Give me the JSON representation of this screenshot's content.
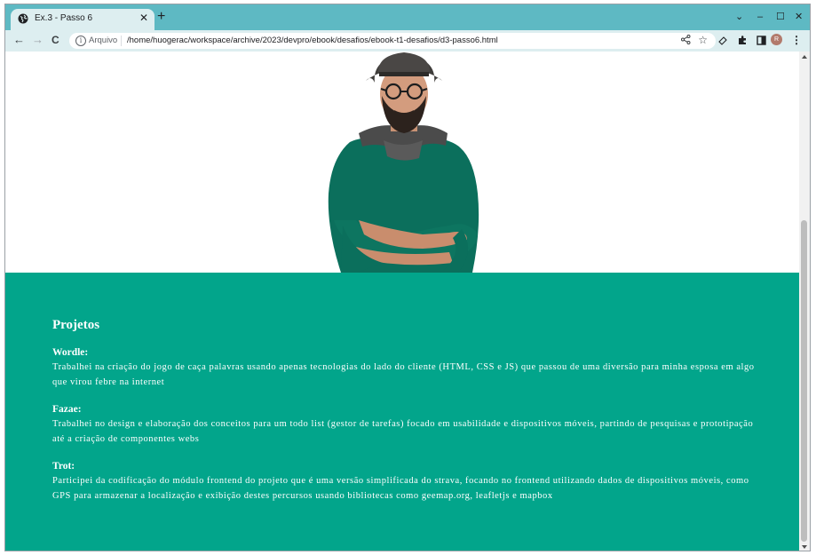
{
  "browser": {
    "tab_title": "Ex.3 - Passo 6",
    "tab_close": "✕",
    "new_tab": "+",
    "window_controls": {
      "dropdown": "⌄",
      "minimize": "–",
      "maximize": "☐",
      "close": "✕"
    },
    "nav": {
      "back": "←",
      "forward": "→",
      "reload": "C"
    },
    "address": {
      "scheme_label": "Arquivo",
      "url": "/home/huogerac/workspace/archive/2023/devpro/ebook/desafios/ebook-t1-desafios/d3-passo6.html"
    },
    "avatar_initial": "R",
    "colors": {
      "tabbar": "#5eb9c3",
      "toolbar": "#ddeef0"
    }
  },
  "page": {
    "hero_image": "man-with-hat-glasses-green-sweater",
    "projects": {
      "heading": "Projetos",
      "items": [
        {
          "title": "Wordle:",
          "description": "Trabalhei na criação do jogo de caça palavras usando apenas tecnologias do lado do cliente (HTML, CSS e JS) que passou de uma diversão para minha esposa em algo que virou febre na internet"
        },
        {
          "title": "Fazae:",
          "description": "Trabalhei no design e elaboração dos conceitos para um todo list (gestor de tarefas) focado em usabilidade e dispositivos móveis, partindo de pesquisas e prototipação até a criação de componentes webs"
        },
        {
          "title": "Trot:",
          "description": "Participei da codificação do módulo frontend do projeto que é uma versão simplificada do strava, focando no frontend utilizando dados de dispositivos móveis, como GPS para armazenar a localização e exibição destes percursos usando bibliotecas como geemap.org, leafletjs e mapbox"
        }
      ],
      "background_color": "#02a58b"
    }
  }
}
